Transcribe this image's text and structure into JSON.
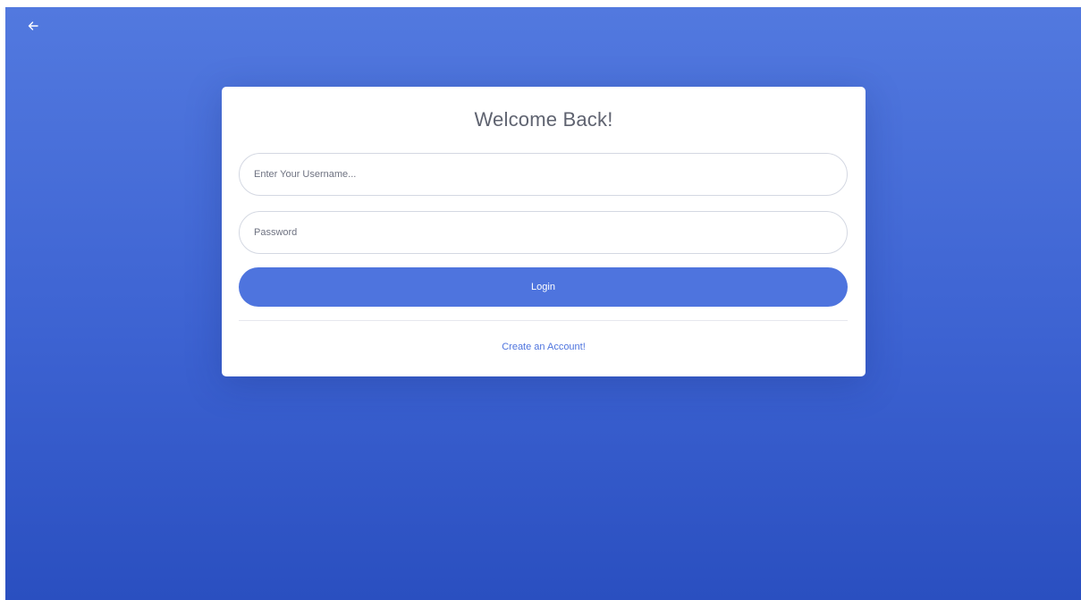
{
  "colors": {
    "background_top": "#5279df",
    "background_bottom": "#2a4fc0",
    "accent": "#4e74de",
    "card": "#ffffff",
    "title_text": "#5f6370"
  },
  "nav": {
    "back_icon": "arrow-left-icon"
  },
  "login_card": {
    "title": "Welcome Back!",
    "username": {
      "placeholder": "Enter Your Username...",
      "value": ""
    },
    "password": {
      "placeholder": "Password",
      "value": ""
    },
    "login_label": "Login",
    "create_account_label": "Create an Account!"
  }
}
